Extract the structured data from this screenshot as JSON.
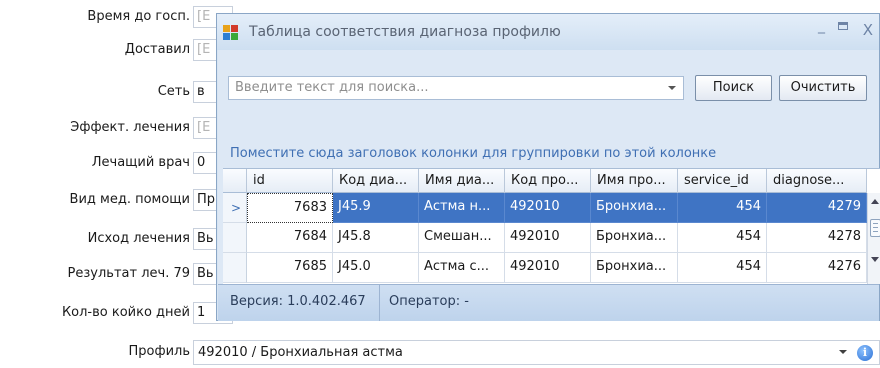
{
  "form": {
    "fields": [
      {
        "label": "Время до госп.",
        "value": "[E",
        "placeholder": true
      },
      {
        "label": "Доставил",
        "value": "[E",
        "placeholder": true
      },
      {
        "label": "Сеть",
        "value": "в",
        "placeholder": false
      },
      {
        "label": "Эффект. лечения",
        "value": "[E",
        "placeholder": true
      },
      {
        "label": "Лечащий врач",
        "value": "0",
        "placeholder": false
      },
      {
        "label": "Вид мед. помощи",
        "value": "Пр",
        "placeholder": false
      },
      {
        "label": "Исход лечения",
        "value": "Вь",
        "placeholder": false
      },
      {
        "label": "Результат леч. 79",
        "value": "Вь",
        "placeholder": false
      },
      {
        "label": "Кол-во койко дней",
        "value": "1",
        "placeholder": false
      }
    ],
    "profile": {
      "label": "Профиль",
      "value": "492010 / Бронхиальная астма"
    }
  },
  "dialog": {
    "title": "Таблица соответствия диагноза профилю",
    "search_placeholder": "Введите текст для поиска...",
    "search_button": "Поиск",
    "clear_button": "Очистить",
    "group_hint": "Поместите сюда заголовок колонки для группировки по этой колонке",
    "grid": {
      "columns": [
        "id",
        "Код диа...",
        "Имя диа...",
        "Код про...",
        "Имя про...",
        "service_id",
        "diagnose..."
      ],
      "rows": [
        [
          "7683",
          "J45.9",
          "Астма н...",
          "492010",
          "Бронхиа...",
          "454",
          "4279"
        ],
        [
          "7684",
          "J45.8",
          "Смешан...",
          "492010",
          "Бронхиа...",
          "454",
          "4278"
        ],
        [
          "7685",
          "J45.0",
          "Астма с...",
          "492010",
          "Бронхиа...",
          "454",
          "4276"
        ]
      ],
      "selected_row": 0
    },
    "status": {
      "version": "Версия: 1.0.402.467",
      "operator": "Оператор: -"
    }
  },
  "colors": {
    "selection": "#3f74c4",
    "hint_text": "#3f6fb3",
    "window_bg": "#d7e4f2"
  }
}
